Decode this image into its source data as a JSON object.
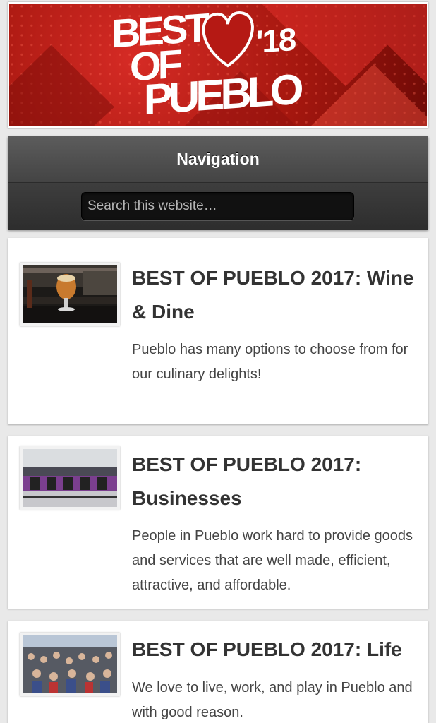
{
  "banner": {
    "title_line1": "BEST",
    "title_line2": "OF",
    "title_line3": "PUEBLO",
    "year": "'18",
    "colors": {
      "primary": "#c1201a",
      "dark": "#6f0a06",
      "heart": "#b51914"
    }
  },
  "nav": {
    "title": "Navigation",
    "search_placeholder": "Search this website…"
  },
  "posts": [
    {
      "title": "BEST OF PUEBLO 2017: Wine & Dine",
      "excerpt": "Pueblo has many options to choose from for our culinary delights!",
      "thumb": "beer-glass-bar-photo"
    },
    {
      "title": "BEST OF PUEBLO 2017: Businesses",
      "excerpt": "People in Pueblo work hard to provide goods and services that are well made, efficient, attractive, and affordable.",
      "thumb": "gym-interior-photo"
    },
    {
      "title": "BEST OF PUEBLO 2017: Life",
      "excerpt": "We love to live, work, and play in Pueblo and with good reason.",
      "thumb": "crowd-event-photo"
    }
  ]
}
